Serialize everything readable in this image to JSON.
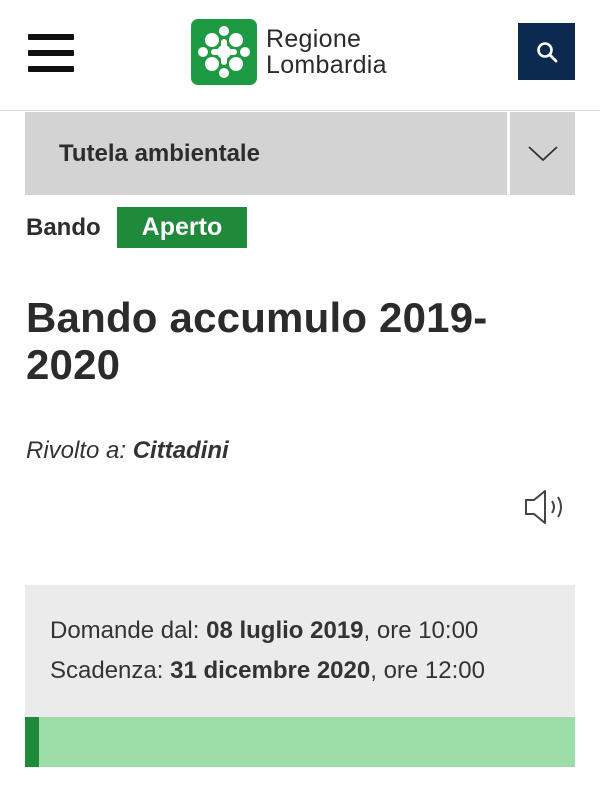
{
  "header": {
    "menu_icon": "hamburger-menu-icon",
    "logo": {
      "line1": "Regione",
      "line2": "Lombardia",
      "brand_color": "#1e9a43"
    },
    "search_icon": "search-icon",
    "search_color": "#0c2a4f"
  },
  "category": {
    "label": "Tutela ambientale",
    "toggle_icon": "chevron-down-icon"
  },
  "status": {
    "label": "Bando",
    "badge": "Aperto",
    "badge_color": "#1f8a3a"
  },
  "title": "Bando accumulo 2019-2020",
  "audience": {
    "prefix": "Rivolto a:",
    "value": "Cittadini"
  },
  "audio_icon": "speaker-icon",
  "dates": {
    "open": {
      "label": "Domande dal:",
      "date": "08 luglio 2019",
      "time": ", ore 10:00"
    },
    "deadline": {
      "label": "Scadenza:",
      "date": "31 dicembre 2020",
      "time": ", ore 12:00"
    }
  },
  "progress": {
    "fill_color": "#9cdca7",
    "accent_color": "#1f8a3a"
  }
}
